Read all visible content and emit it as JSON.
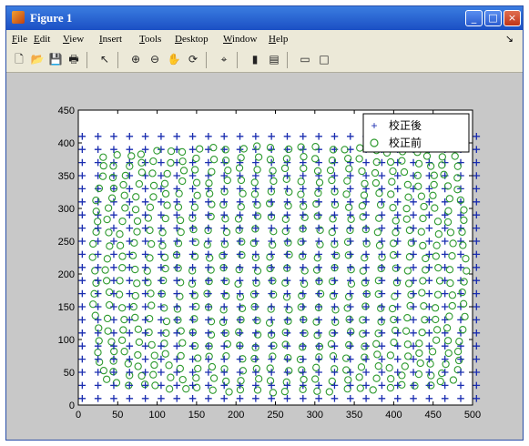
{
  "window": {
    "title": "Figure 1"
  },
  "titlebar_buttons": {
    "minimize": "_",
    "maximize": "□",
    "close": "×"
  },
  "menu": [
    "File",
    "Edit",
    "View",
    "Insert",
    "Tools",
    "Desktop",
    "Window",
    "Help"
  ],
  "menu_overflow": "↘",
  "toolbar": {
    "tools": [
      {
        "name": "new-figure-icon",
        "glyph": "🗋"
      },
      {
        "name": "open-file-icon",
        "glyph": "📂"
      },
      {
        "name": "save-icon",
        "glyph": "💾"
      },
      {
        "name": "print-icon",
        "glyph": "🖶"
      },
      {
        "name": "edit-plot-arrow-icon",
        "glyph": "↖"
      },
      {
        "name": "zoom-in-icon",
        "glyph": "⊕"
      },
      {
        "name": "zoom-out-icon",
        "glyph": "⊖"
      },
      {
        "name": "pan-hand-icon",
        "glyph": "✋"
      },
      {
        "name": "rotate-3d-icon",
        "glyph": "⟳"
      },
      {
        "name": "data-cursor-icon",
        "glyph": "⌖"
      },
      {
        "name": "colorbar-icon",
        "glyph": "▮"
      },
      {
        "name": "legend-icon",
        "glyph": "▤"
      },
      {
        "name": "hide-plot-tools-icon",
        "glyph": "▭"
      },
      {
        "name": "show-plot-tools-icon",
        "glyph": "□"
      }
    ]
  },
  "colors": {
    "corrected": "#1a2db0",
    "uncorrected": "#2e9a2e"
  },
  "chart_data": {
    "type": "scatter",
    "xlim": [
      0,
      500
    ],
    "ylim": [
      0,
      450
    ],
    "x_ticks": [
      "0",
      "50",
      "100",
      "150",
      "200",
      "250",
      "300",
      "350",
      "400",
      "450",
      "500"
    ],
    "y_ticks": [
      "0",
      "50",
      "100",
      "150",
      "200",
      "250",
      "300",
      "350",
      "400",
      "450"
    ],
    "grid": false,
    "legend_position": "top-right",
    "series": [
      {
        "name": "校正後",
        "marker": "+",
        "grid_x": [
          5,
          505,
          20
        ],
        "grid_y": [
          10,
          410,
          20
        ]
      },
      {
        "name": "校正前",
        "marker": "o",
        "grid_x": [
          5,
          505,
          20
        ],
        "grid_y": [
          10,
          410,
          20
        ],
        "radial_distortion": true
      }
    ]
  }
}
